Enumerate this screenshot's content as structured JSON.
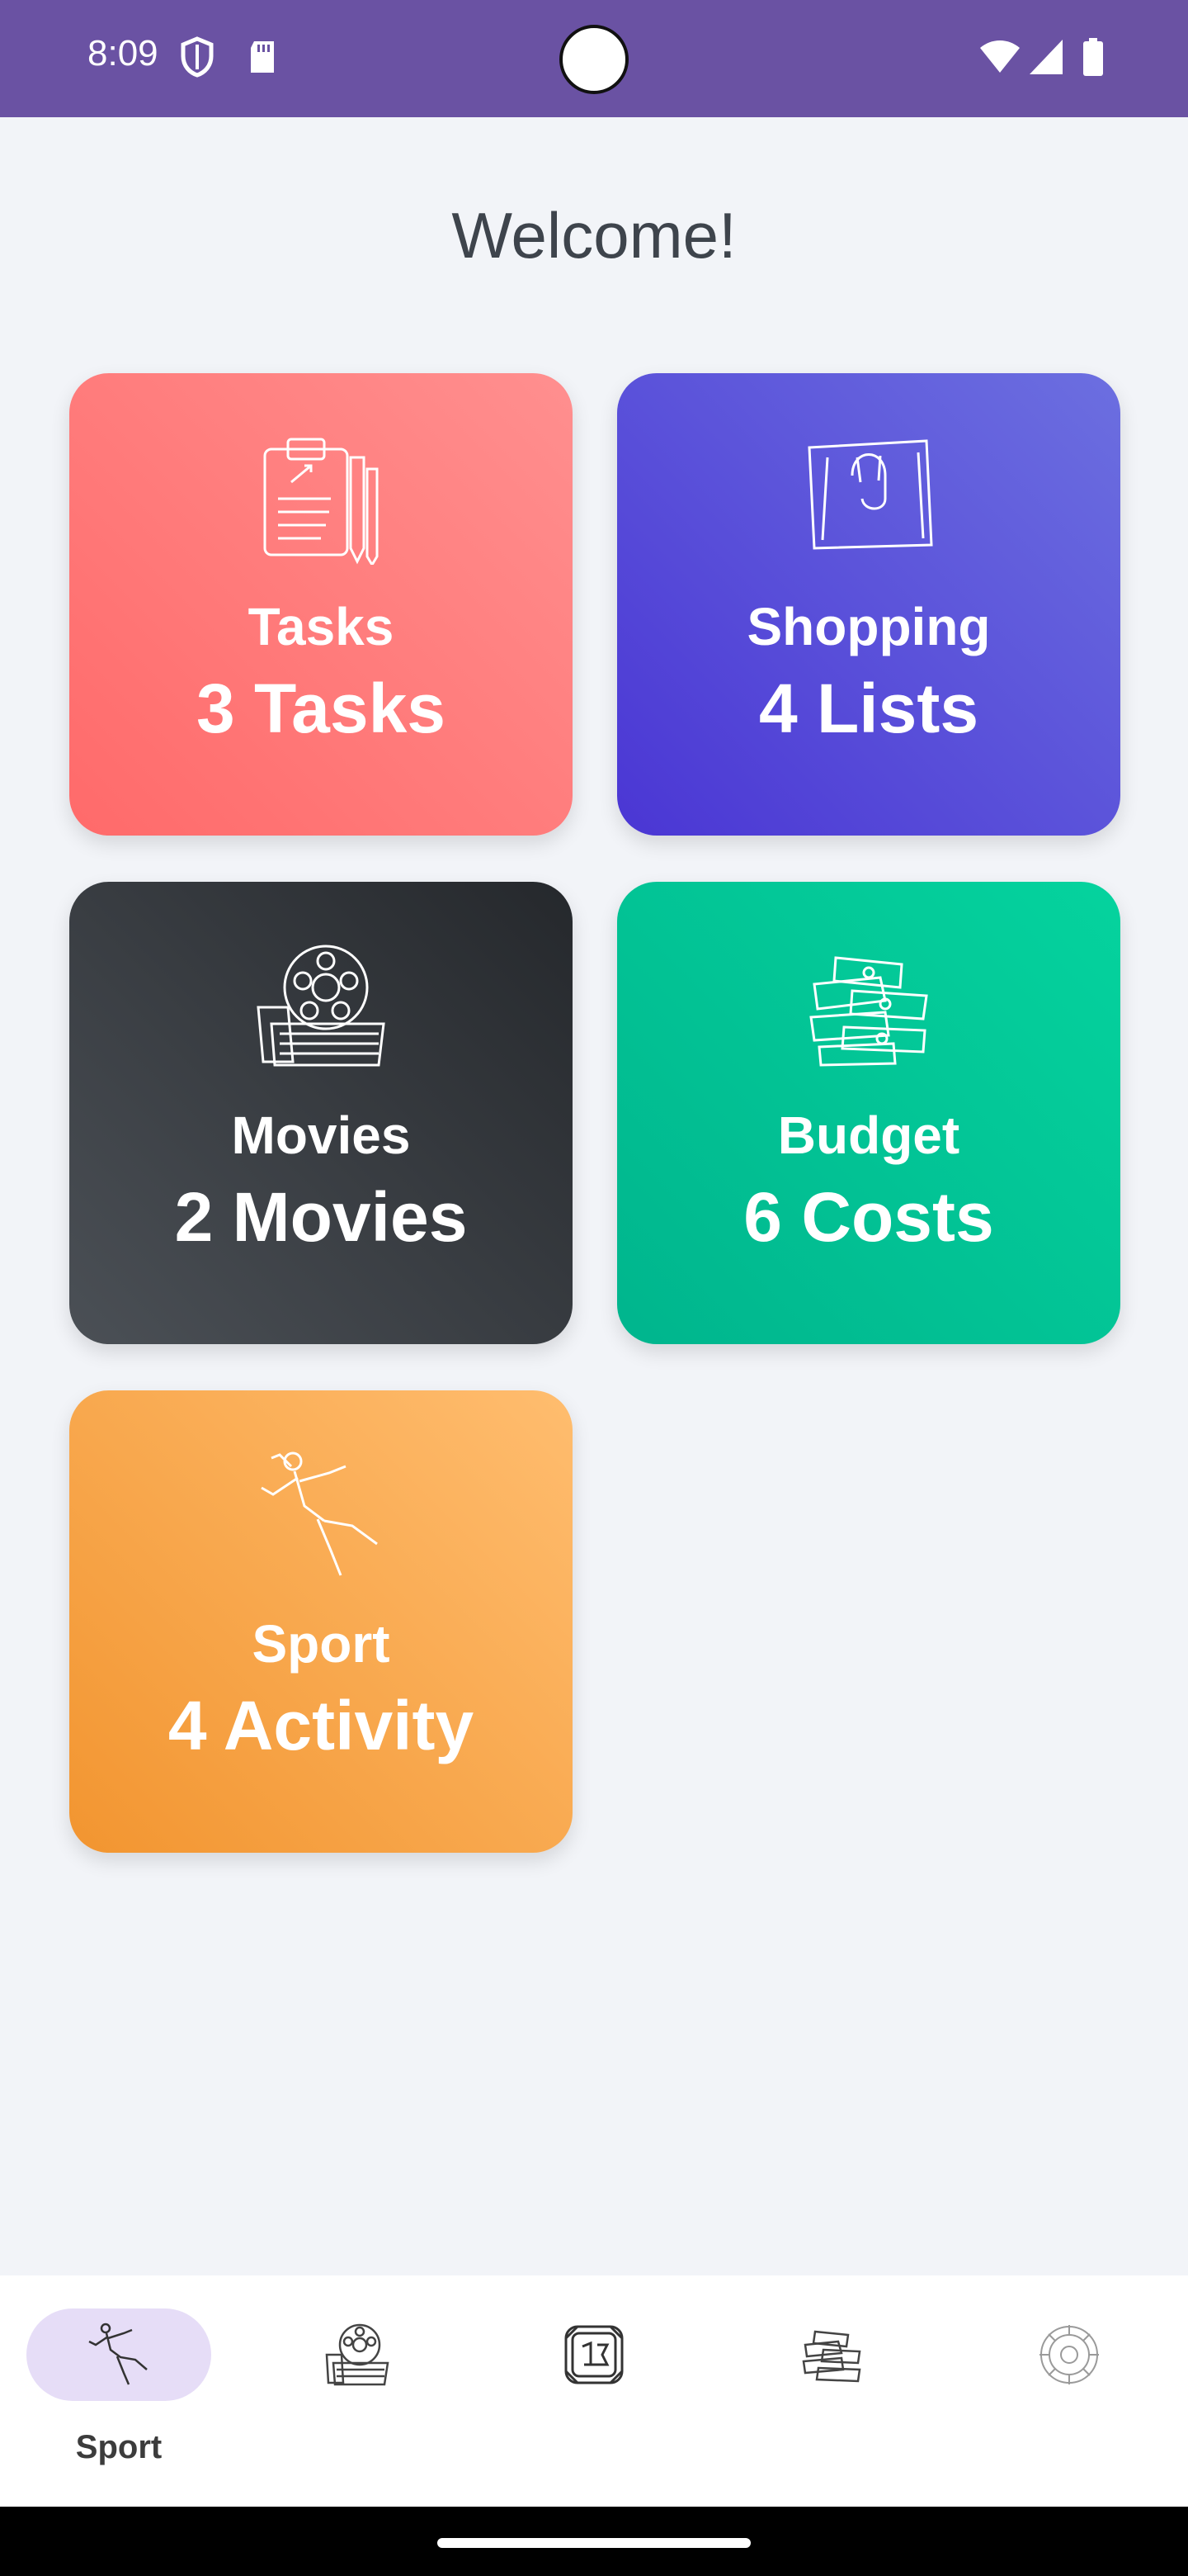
{
  "status_bar": {
    "time": "8:09",
    "icons": [
      "shield-icon",
      "sd-card-icon",
      "wifi-icon",
      "signal-icon",
      "battery-icon"
    ]
  },
  "page": {
    "title": "Welcome!"
  },
  "cards": {
    "tasks": {
      "title": "Tasks",
      "count": "3 Tasks",
      "icon": "clipboard-icon",
      "color": "#ff7575"
    },
    "shopping": {
      "title": "Shopping",
      "count": "4 Lists",
      "icon": "shopping-bag-icon",
      "color": "#5546da"
    },
    "movies": {
      "title": "Movies",
      "count": "2 Movies",
      "icon": "film-reel-icon",
      "color": "#32363b"
    },
    "budget": {
      "title": "Budget",
      "count": "6 Costs",
      "icon": "money-stack-icon",
      "color": "#00c79a"
    },
    "sport": {
      "title": "Sport",
      "count": "4 Activity",
      "icon": "runner-icon",
      "color": "#f7a84d"
    }
  },
  "bottom_nav": {
    "items": [
      {
        "label": "Sport",
        "icon": "runner-icon",
        "selected": true
      },
      {
        "label": "",
        "icon": "film-reel-icon",
        "selected": false
      },
      {
        "label": "",
        "icon": "tasks-icon",
        "selected": false
      },
      {
        "label": "",
        "icon": "money-stack-icon",
        "selected": false
      },
      {
        "label": "",
        "icon": "settings-icon",
        "selected": false
      }
    ]
  }
}
